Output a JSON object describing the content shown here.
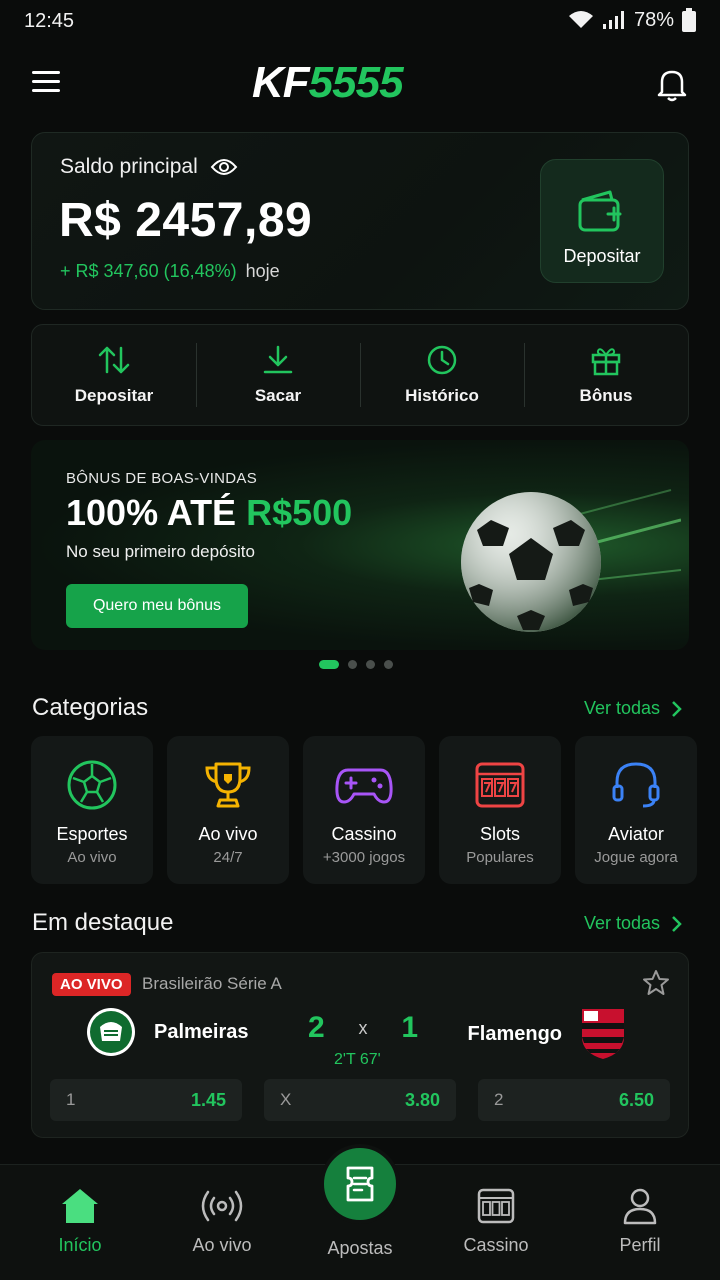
{
  "status_bar": {
    "time": "12:45",
    "battery": "78%"
  },
  "header": {
    "logo_kf": "KF",
    "logo_num": "5555"
  },
  "balance": {
    "label": "Saldo principal",
    "value": "R$ 2457,89",
    "change": "+ R$ 347,60 (16,48%)",
    "change_suffix": "hoje",
    "deposit_label": "Depositar"
  },
  "actions": [
    {
      "label": "Depositar",
      "icon": "transfer-icon"
    },
    {
      "label": "Sacar",
      "icon": "download-icon"
    },
    {
      "label": "Histórico",
      "icon": "clock-icon"
    },
    {
      "label": "Bônus",
      "icon": "gift-icon"
    }
  ],
  "promo": {
    "eyebrow": "BÔNUS DE BOAS-VINDAS",
    "headline_white": "100% ATÉ ",
    "headline_green": "R$500",
    "sub": "No seu primeiro depósito",
    "cta": "Quero meu bônus",
    "active_slide": 1,
    "slides": 4
  },
  "categories": {
    "title": "Categorias",
    "see_all": "Ver todas",
    "items": [
      {
        "name": "Esportes",
        "note": "Ao vivo",
        "icon": "soccer-ball-icon"
      },
      {
        "name": "Ao vivo",
        "note": "24/7",
        "icon": "trophy-icon"
      },
      {
        "name": "Cassino",
        "note": "+3000 jogos",
        "icon": "gamepad-icon"
      },
      {
        "name": "Slots",
        "note": "Populares",
        "icon": "slot-machine-icon"
      },
      {
        "name": "Aviator",
        "note": "Jogue agora",
        "icon": "headset-icon"
      }
    ]
  },
  "featured": {
    "title": "Em destaque",
    "see_all": "Ver todas",
    "match": {
      "badge": "AO VIVO",
      "league": "Brasileirão Série A",
      "home": "Palmeiras",
      "away": "Flamengo",
      "home_score": "2",
      "separator": "x",
      "away_score": "1",
      "clock": "2'T 67'",
      "odds": [
        {
          "key": "1",
          "value": "1.45"
        },
        {
          "key": "X",
          "value": "3.80"
        },
        {
          "key": "2",
          "value": "6.50"
        }
      ]
    }
  },
  "bottom_nav": {
    "items": [
      {
        "label": "Início",
        "icon": "home-icon",
        "active": true
      },
      {
        "label": "Ao vivo",
        "icon": "broadcast-icon"
      },
      {
        "label": "Apostas",
        "icon": "ticket-icon"
      },
      {
        "label": "Cassino",
        "icon": "slot-machine-icon"
      },
      {
        "label": "Perfil",
        "icon": "user-icon"
      }
    ]
  },
  "colors": {
    "accent": "#22c55e",
    "live": "#dc2626",
    "background": "#0a0c0b"
  }
}
